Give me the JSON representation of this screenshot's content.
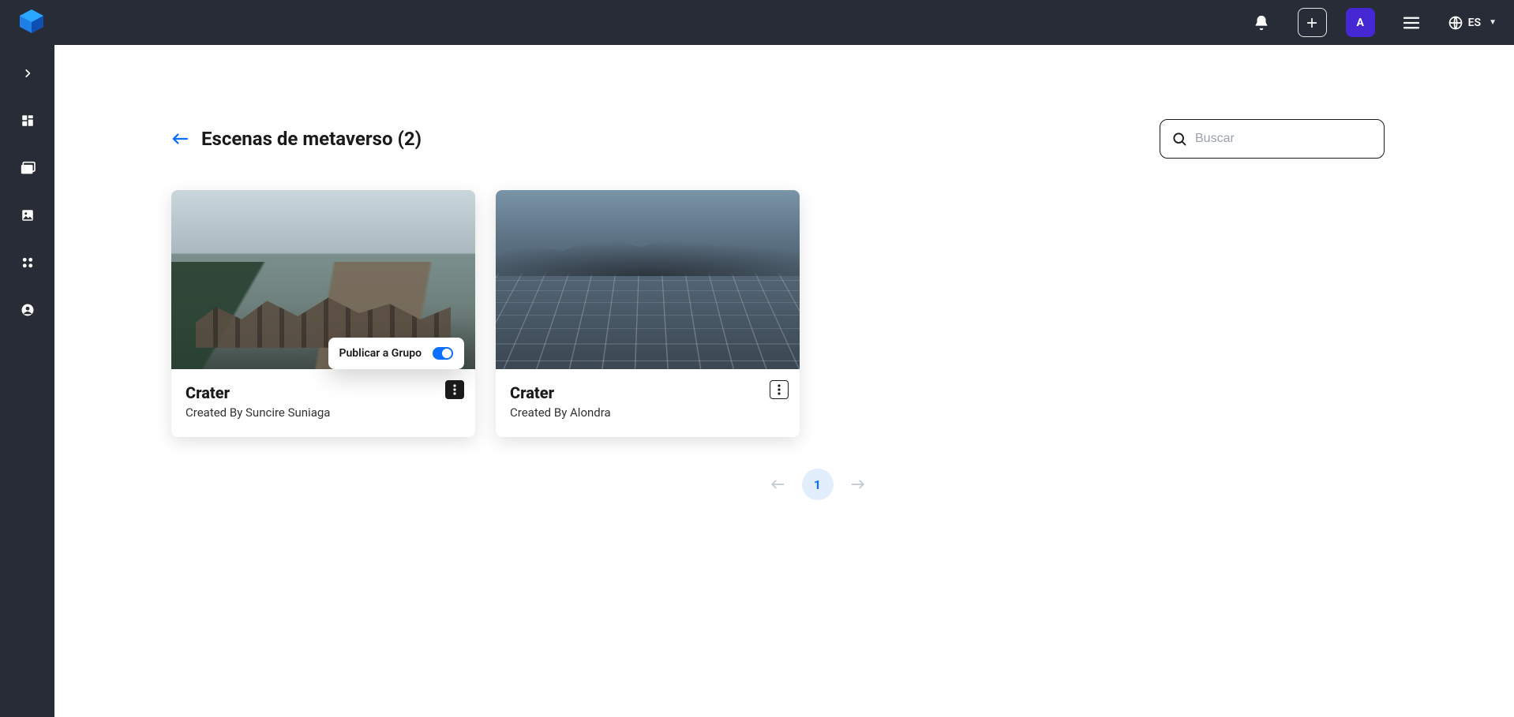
{
  "topbar": {
    "avatar_initial": "A",
    "language_label": "ES"
  },
  "page": {
    "title": "Escenas de metaverso (2)"
  },
  "search": {
    "placeholder": "Buscar",
    "value": ""
  },
  "scenes": [
    {
      "title": "Crater",
      "created_by": "Created By Suncire Suniaga",
      "menu_open": true,
      "popover_label": "Publicar a Grupo",
      "popover_toggle_on": true
    },
    {
      "title": "Crater",
      "created_by": "Created By Alondra",
      "menu_open": false
    }
  ],
  "pagination": {
    "current": "1"
  }
}
